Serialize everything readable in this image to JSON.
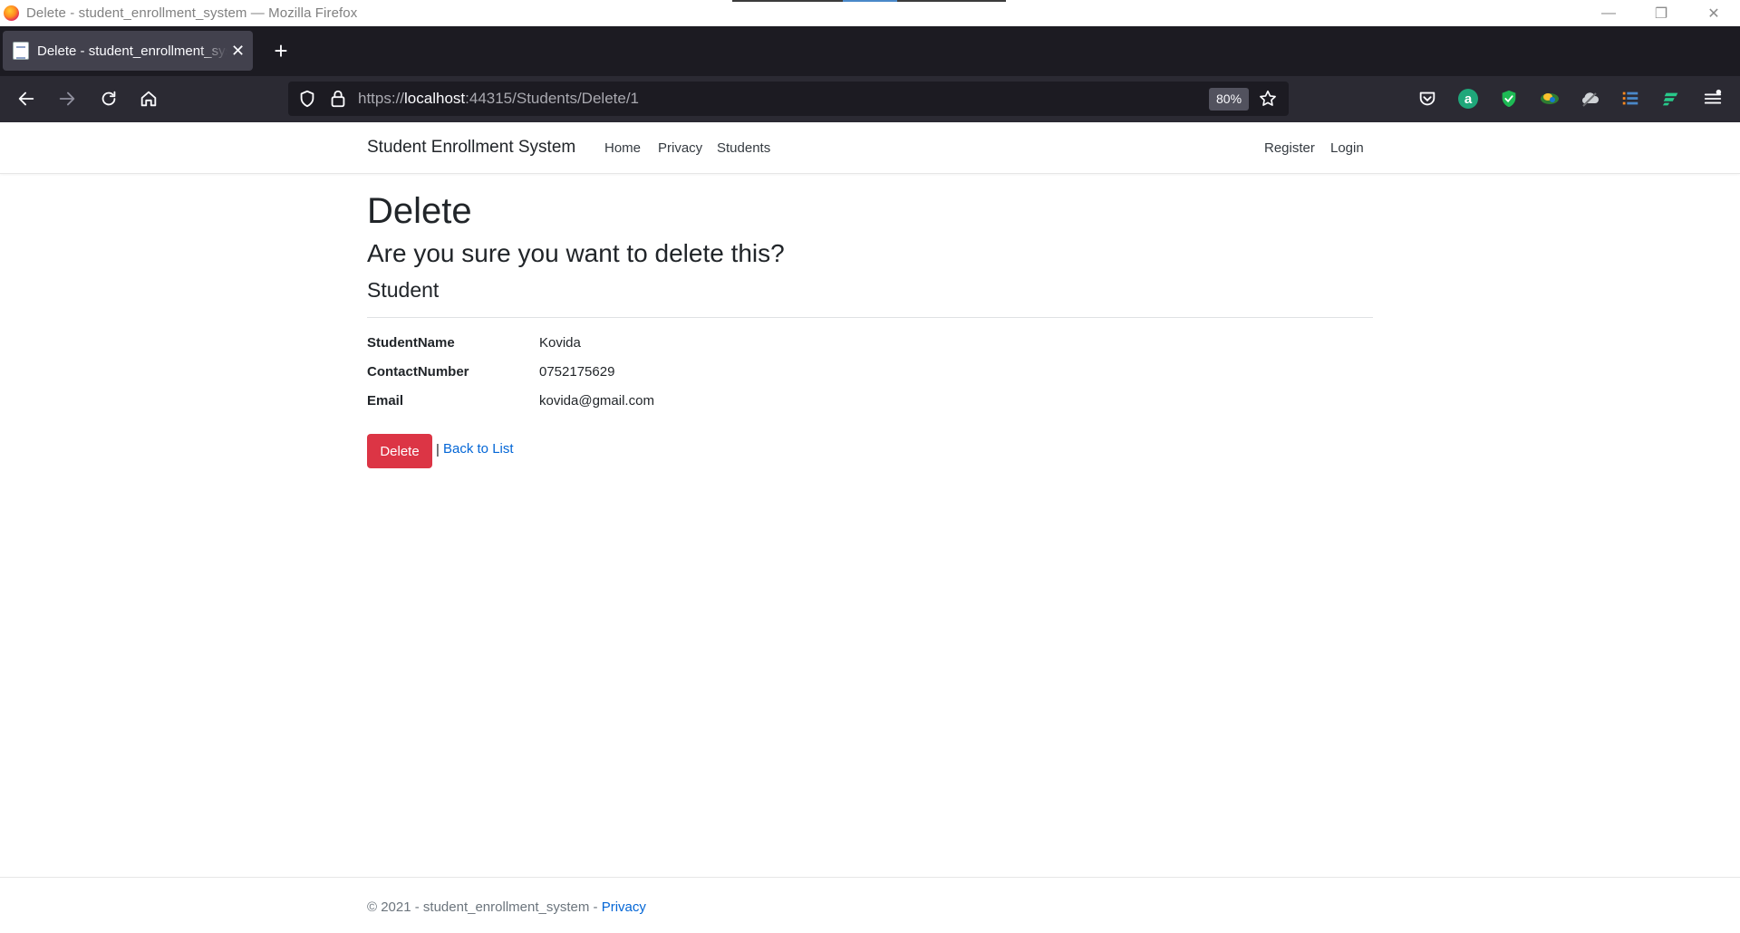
{
  "window": {
    "title": "Delete - student_enrollment_system — Mozilla Firefox",
    "controls": [
      "minimize",
      "restore",
      "close"
    ]
  },
  "tabs": [
    {
      "title": "Delete - student_enrollment_system",
      "active": true
    }
  ],
  "toolbar": {
    "url_scheme": "https://",
    "url_host": "localhost",
    "url_rest": ":44315/Students/Delete/1",
    "zoom": "80%"
  },
  "navbar": {
    "brand": "Student Enrollment System",
    "links": [
      "Home",
      "Privacy",
      "Students"
    ],
    "right_links": [
      "Register",
      "Login"
    ]
  },
  "page": {
    "heading": "Delete",
    "question": "Are you sure you want to delete this?",
    "entity": "Student",
    "fields": [
      {
        "label": "StudentName",
        "value": "Kovida"
      },
      {
        "label": "ContactNumber",
        "value": "0752175629"
      },
      {
        "label": "Email",
        "value": "kovida@gmail.com"
      }
    ],
    "delete_button": "Delete",
    "separator": "|",
    "back_link": "Back to List"
  },
  "footer": {
    "text": "© 2021 - student_enrollment_system - ",
    "link": "Privacy"
  },
  "colors": {
    "danger": "#dc3545",
    "link": "#0366d6",
    "browser_dark": "#1c1b22",
    "toolbar": "#2b2a33"
  }
}
